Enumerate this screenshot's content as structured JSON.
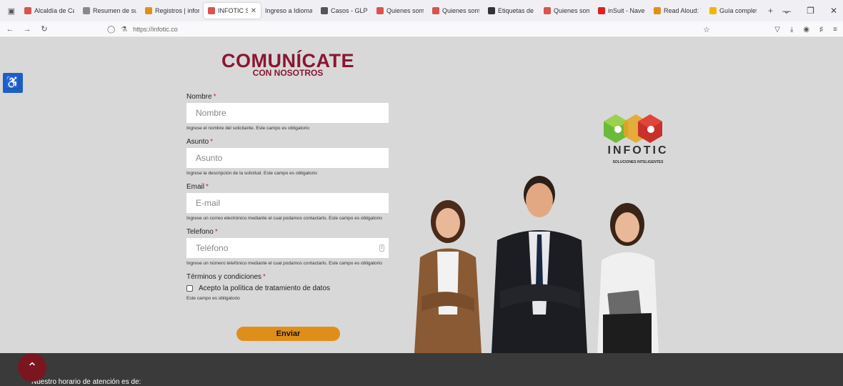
{
  "browser": {
    "tabs": [
      {
        "label": "Alcaldía de Cal",
        "color": "#d9534f"
      },
      {
        "label": "Resumen de su",
        "color": "#888888"
      },
      {
        "label": "Registros | infor",
        "color": "#e08e1a"
      },
      {
        "label": "INFOTIC S.A",
        "color": "#d9534f",
        "active": true
      },
      {
        "label": "Ingreso a Idiomas E",
        "color": "#ffffff"
      },
      {
        "label": "Casos - GLPI",
        "color": "#555555"
      },
      {
        "label": "Quienes somos",
        "color": "#d9534f"
      },
      {
        "label": "Quienes somos",
        "color": "#d9534f"
      },
      {
        "label": "Etiquetas de to",
        "color": "#333333"
      },
      {
        "label": "Quienes somos",
        "color": "#d9534f"
      },
      {
        "label": "inSuit - Navega",
        "color": "#e02020"
      },
      {
        "label": "Read Aloud: Te",
        "color": "#e08e1a"
      },
      {
        "label": "Guía completa",
        "color": "#f4b400"
      }
    ],
    "url": "https://infotic.co",
    "new_tab_icon": "plus-icon",
    "tab_list_icon": "chevron-down-icon"
  },
  "page": {
    "title_main": "COMUNÍCATE",
    "title_sub": "CON NOSOTROS",
    "fields": [
      {
        "label": "Nombre",
        "required": "*",
        "placeholder": "Nombre",
        "help": "Ingrese el nombre del solicitante. Este campo es obligatorio"
      },
      {
        "label": "Asunto",
        "required": "*",
        "placeholder": "Asunto",
        "help": "Ingrese la descripción de la solicitud. Este campo es obligatorio"
      },
      {
        "label": "Email",
        "required": "*",
        "placeholder": "E-mail",
        "help": "Ingrese un correo electrónico mediante el cual podamos contactarlo. Este campo es obligatorio"
      },
      {
        "label": "Telefono",
        "required": "*",
        "placeholder": "Teléfono",
        "help": "Ingrese un número telefónico mediante el cual podamos contactarlo. Este campo es obligatorio"
      }
    ],
    "terms": {
      "label": "Términos y condiciones",
      "required": "*",
      "checkbox_label": "Acepto la política de tratamiento de datos",
      "help": "Este campo es obligatorio"
    },
    "submit_label": "Enviar",
    "logo": {
      "word": "INFOTIC",
      "tagline": "SOLUCIONES INTELIGENTES"
    },
    "footer_text": "Nuestro horario de atención es de:",
    "accent": "#8a1632",
    "button_color": "#e08e1a"
  }
}
